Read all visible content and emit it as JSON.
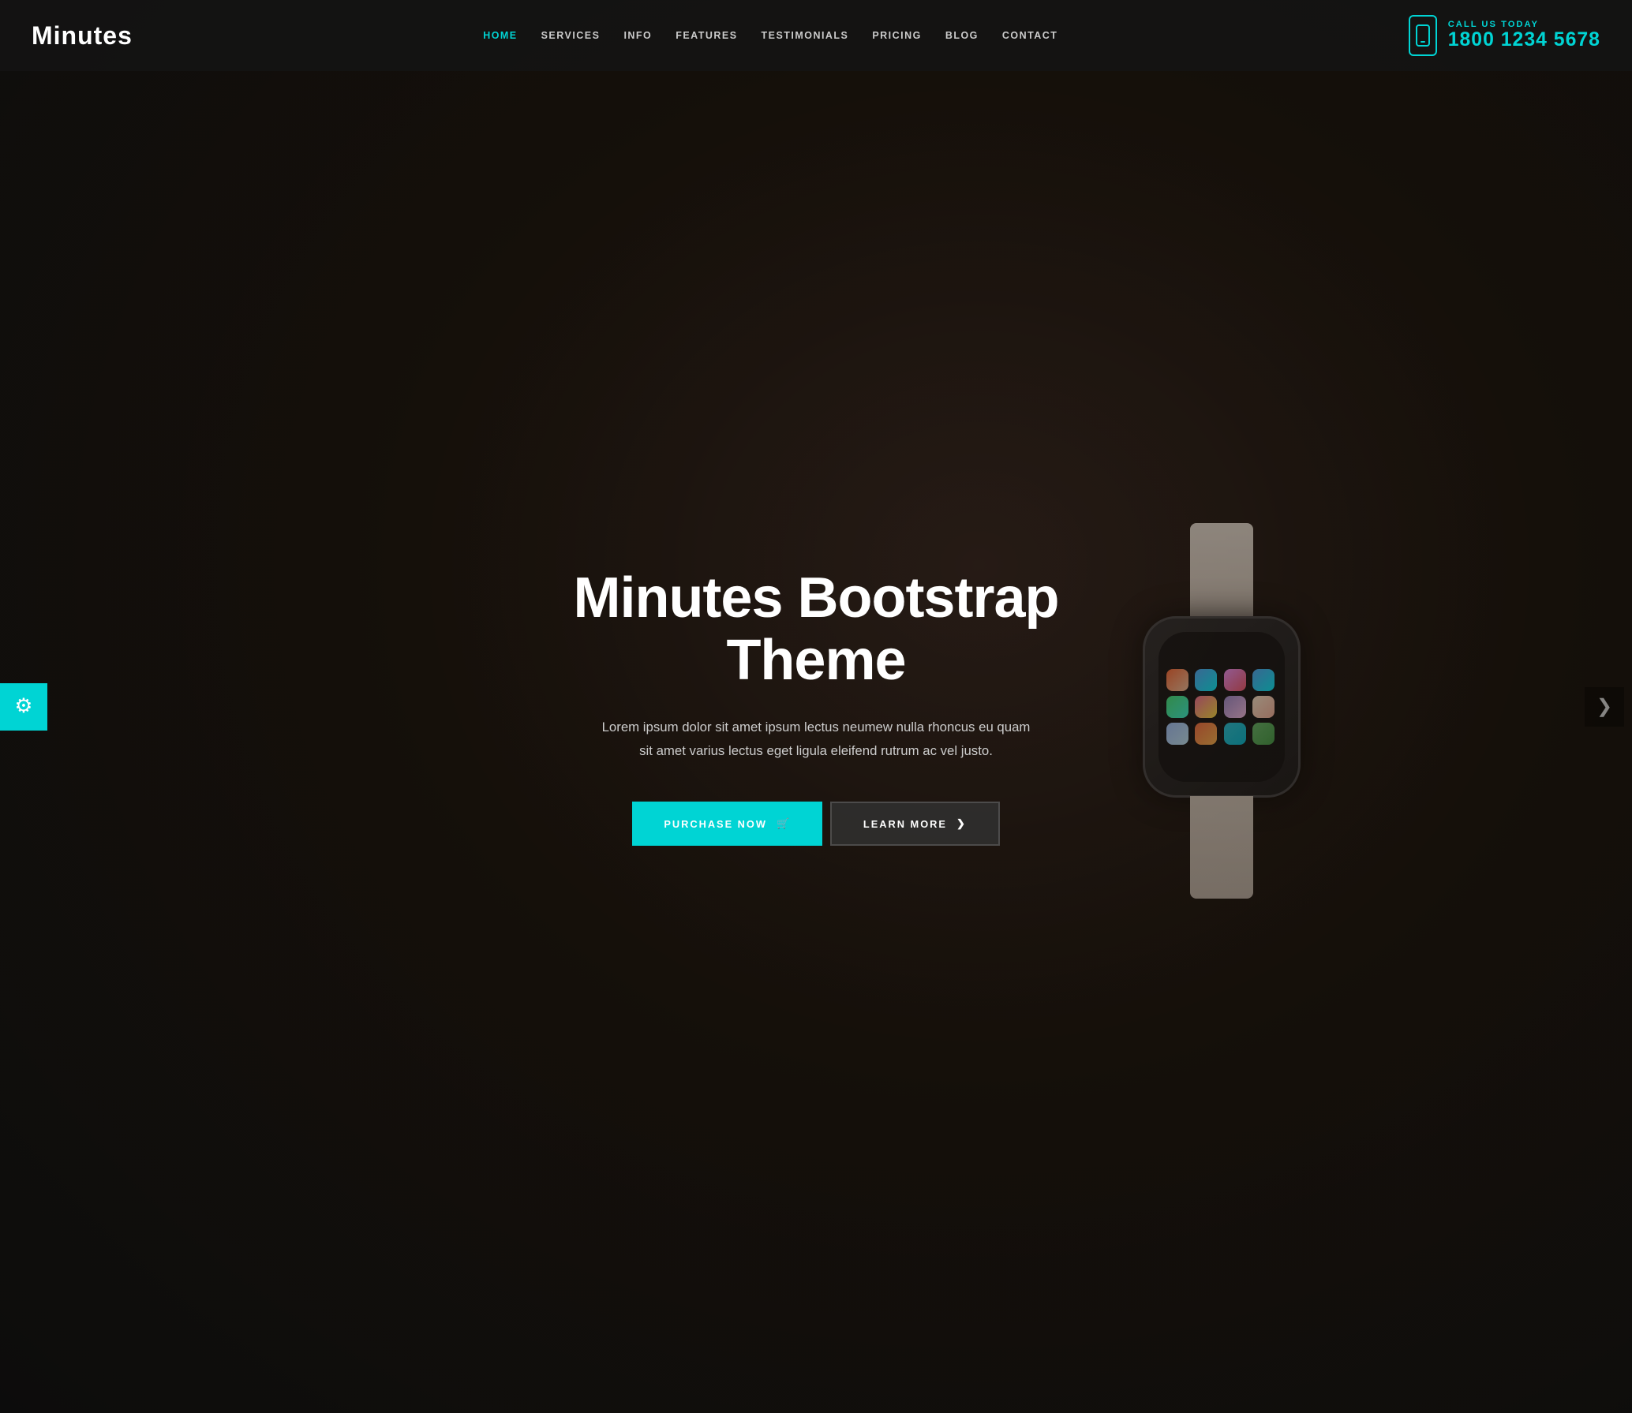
{
  "site": {
    "logo": "Minutes",
    "tagline": "Minutes Bootstrap Theme"
  },
  "header": {
    "nav": [
      {
        "id": "home",
        "label": "HOME",
        "active": true
      },
      {
        "id": "services",
        "label": "SERVICES",
        "active": false
      },
      {
        "id": "info",
        "label": "INFO",
        "active": false
      },
      {
        "id": "features",
        "label": "FEATURES",
        "active": false
      },
      {
        "id": "testimonials",
        "label": "TESTIMONIALS",
        "active": false
      },
      {
        "id": "pricing",
        "label": "PRICING",
        "active": false
      },
      {
        "id": "blog",
        "label": "BLOG",
        "active": false
      },
      {
        "id": "contact",
        "label": "CONTACT",
        "active": false
      }
    ],
    "call_label": "CALL US TODAY",
    "phone": "1800 1234 5678"
  },
  "hero": {
    "title": "Minutes Bootstrap Theme",
    "subtitle": "Lorem ipsum dolor sit amet ipsum lectus neumew nulla rhoncus eu quam sit amet varius lectus eget ligula eleifend rutrum ac vel justo.",
    "btn_purchase": "PURCHASE NOW",
    "btn_learn": "LEARN MORE",
    "cart_icon": "🛒",
    "arrow_icon": "❯"
  },
  "settings": {
    "icon": "⚙"
  },
  "colors": {
    "accent": "#00d4d4",
    "bg_dark": "#1a1a1a",
    "text_light": "#ffffff",
    "text_muted": "#cccccc"
  }
}
